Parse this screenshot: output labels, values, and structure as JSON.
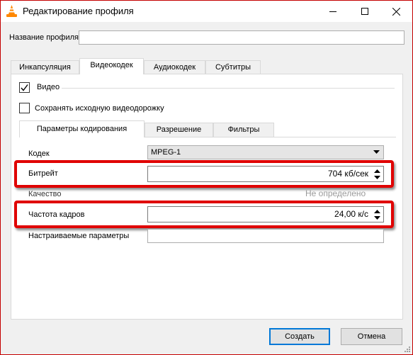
{
  "window": {
    "title": "Редактирование профиля"
  },
  "profile": {
    "name_label": "Название профиля",
    "name_value": ""
  },
  "tabs": [
    "Инкапсуляция",
    "Видеокодек",
    "Аудиокодек",
    "Субтитры"
  ],
  "video": {
    "checkbox_label": "Видео",
    "checked": true,
    "keep_original_label": "Сохранять исходную видеодорожку",
    "keep_original_checked": false
  },
  "subtabs": [
    "Параметры кодирования",
    "Разрешение",
    "Фильтры"
  ],
  "encoding": {
    "codec_label": "Кодек",
    "codec_value": "MPEG-1",
    "bitrate_label": "Битрейт",
    "bitrate_value": "704 кб/сек",
    "quality_label": "Качество",
    "quality_value": "Не определено",
    "framerate_label": "Частота кадров",
    "framerate_value": "24,00 к/с",
    "custom_label": "Настраиваемые параметры",
    "custom_value": ""
  },
  "buttons": {
    "create": "Создать",
    "cancel": "Отмена"
  },
  "colors": {
    "highlight": "#e00000",
    "accent": "#0078d7"
  }
}
